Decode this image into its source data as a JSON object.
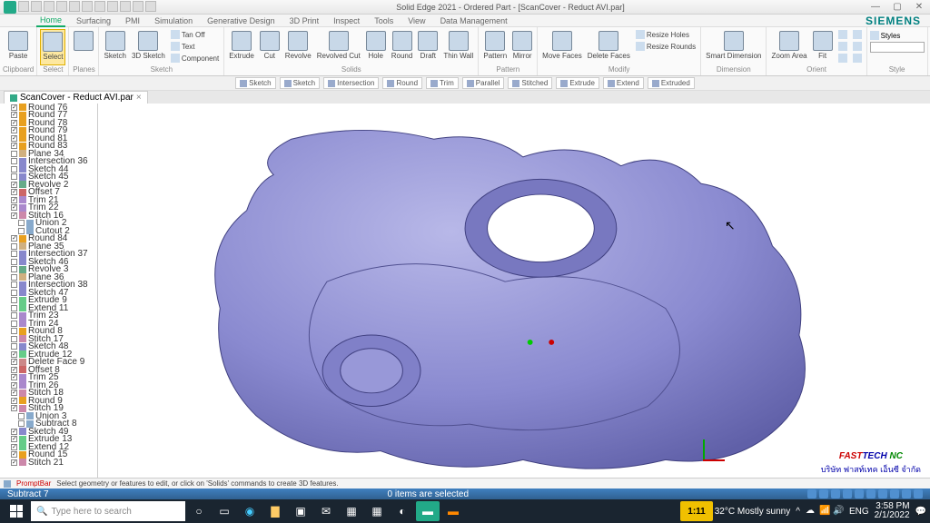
{
  "titlebar": {
    "title": "Solid Edge 2021 - Ordered Part - [ScanCover - Reduct AVI.par]"
  },
  "tabs": [
    "Home",
    "Surfacing",
    "PMI",
    "Simulation",
    "Generative Design",
    "3D Print",
    "Inspect",
    "Tools",
    "View",
    "Data Management"
  ],
  "active_tab": 0,
  "brand": "SIEMENS",
  "ribbon": {
    "clipboard": {
      "label": "Clipboard",
      "paste": "Paste"
    },
    "select": {
      "label": "Select",
      "select": "Select"
    },
    "planes": {
      "label": "Planes"
    },
    "sketch": {
      "label": "Sketch",
      "sketch": "Sketch",
      "sketch3d": "3D Sketch",
      "tanoff": "Tan Off",
      "text": "Text",
      "component": "Component"
    },
    "solids": {
      "label": "Solids",
      "extrude": "Extrude",
      "cut": "Cut",
      "revolve": "Revolve",
      "revolvedcut": "Revolved Cut",
      "hole": "Hole",
      "round": "Round",
      "draft": "Draft",
      "thinwall": "Thin Wall"
    },
    "pattern": {
      "label": "Pattern",
      "pattern": "Pattern",
      "mirror": "Mirror"
    },
    "modify": {
      "label": "Modify",
      "move": "Move Faces",
      "delete": "Delete Faces",
      "resizeholes": "Resize Holes",
      "resizerounds": "Resize Rounds"
    },
    "dimension": {
      "label": "Dimension",
      "smart": "Smart Dimension"
    },
    "orient": {
      "label": "Orient",
      "zoom": "Zoom Area",
      "fit": "Fit"
    },
    "style": {
      "label": "Style",
      "styles": "Styles"
    }
  },
  "filters": [
    "Sketch",
    "Sketch",
    "Intersection",
    "Round",
    "Trim",
    "Parallel",
    "Stitched",
    "Extrude",
    "Extend",
    "Extruded"
  ],
  "doc_tab": {
    "name": "ScanCover - Reduct AVI.par"
  },
  "tree": [
    {
      "c": 1,
      "t": "round",
      "l": "Round 76",
      "i": 1
    },
    {
      "c": 1,
      "t": "round",
      "l": "Round 77",
      "i": 1
    },
    {
      "c": 1,
      "t": "round",
      "l": "Round 78",
      "i": 1
    },
    {
      "c": 1,
      "t": "round",
      "l": "Round 79",
      "i": 1
    },
    {
      "c": 1,
      "t": "round",
      "l": "Round 81",
      "i": 1
    },
    {
      "c": 1,
      "t": "round",
      "l": "Round 83",
      "i": 1
    },
    {
      "c": 0,
      "t": "plane",
      "l": "Plane 34",
      "i": 1
    },
    {
      "c": 0,
      "t": "sketch",
      "l": "Intersection 36",
      "i": 1
    },
    {
      "c": 0,
      "t": "sketch",
      "l": "Sketch 44",
      "i": 1
    },
    {
      "c": 0,
      "t": "sketch",
      "l": "Sketch 45",
      "i": 1
    },
    {
      "c": 1,
      "t": "revolve",
      "l": "Revolve 2",
      "i": 1
    },
    {
      "c": 1,
      "t": "offset",
      "l": "Offset 7",
      "i": 1
    },
    {
      "c": 1,
      "t": "trim",
      "l": "Trim 21",
      "i": 1
    },
    {
      "c": 1,
      "t": "trim",
      "l": "Trim 22",
      "i": 1
    },
    {
      "c": 1,
      "t": "stitch",
      "l": "Stitch 16",
      "i": 1
    },
    {
      "c": 0,
      "t": "union",
      "l": "Union 2",
      "i": 2
    },
    {
      "c": 0,
      "t": "union",
      "l": "Cutout 2",
      "i": 2
    },
    {
      "c": 1,
      "t": "round",
      "l": "Round 84",
      "i": 1
    },
    {
      "c": 0,
      "t": "plane",
      "l": "Plane 35",
      "i": 1
    },
    {
      "c": 0,
      "t": "sketch",
      "l": "Intersection 37",
      "i": 1
    },
    {
      "c": 0,
      "t": "sketch",
      "l": "Sketch 46",
      "i": 1
    },
    {
      "c": 0,
      "t": "revolve",
      "l": "Revolve 3",
      "i": 1
    },
    {
      "c": 0,
      "t": "plane",
      "l": "Plane 36",
      "i": 1
    },
    {
      "c": 0,
      "t": "sketch",
      "l": "Intersection 38",
      "i": 1
    },
    {
      "c": 0,
      "t": "sketch",
      "l": "Sketch 47",
      "i": 1
    },
    {
      "c": 0,
      "t": "extrude",
      "l": "Extrude 9",
      "i": 1
    },
    {
      "c": 0,
      "t": "extrude",
      "l": "Extend 11",
      "i": 1
    },
    {
      "c": 0,
      "t": "trim",
      "l": "Trim 23",
      "i": 1
    },
    {
      "c": 0,
      "t": "trim",
      "l": "Trim 24",
      "i": 1
    },
    {
      "c": 0,
      "t": "round",
      "l": "Round 8",
      "i": 1
    },
    {
      "c": 0,
      "t": "stitch",
      "l": "Stitch 17",
      "i": 1
    },
    {
      "c": 0,
      "t": "sketch",
      "l": "Sketch 48",
      "i": 1
    },
    {
      "c": 1,
      "t": "extrude",
      "l": "Extrude 12",
      "i": 1
    },
    {
      "c": 1,
      "t": "delete",
      "l": "Delete Face 9",
      "i": 1
    },
    {
      "c": 1,
      "t": "offset",
      "l": "Offset 8",
      "i": 1
    },
    {
      "c": 1,
      "t": "trim",
      "l": "Trim 25",
      "i": 1
    },
    {
      "c": 1,
      "t": "trim",
      "l": "Trim 26",
      "i": 1
    },
    {
      "c": 1,
      "t": "stitch",
      "l": "Stitch 18",
      "i": 1
    },
    {
      "c": 1,
      "t": "round",
      "l": "Round 9",
      "i": 1
    },
    {
      "c": 1,
      "t": "stitch",
      "l": "Stitch 19",
      "i": 1
    },
    {
      "c": 0,
      "t": "union",
      "l": "Union 3",
      "i": 2
    },
    {
      "c": 0,
      "t": "union",
      "l": "Subtract 8",
      "i": 2
    },
    {
      "c": 1,
      "t": "sketch",
      "l": "Sketch 49",
      "i": 1
    },
    {
      "c": 1,
      "t": "extrude",
      "l": "Extrude 13",
      "i": 1
    },
    {
      "c": 1,
      "t": "extrude",
      "l": "Extend 12",
      "i": 1
    },
    {
      "c": 1,
      "t": "round",
      "l": "Round 15",
      "i": 1
    },
    {
      "c": 1,
      "t": "stitch",
      "l": "Stitch 21",
      "i": 1
    }
  ],
  "prompt": {
    "label": "PromptBar",
    "text": "Select geometry or features to edit, or click on 'Solids' commands to create 3D features."
  },
  "status": {
    "left": "Subtract 7",
    "mid": "0 items are selected"
  },
  "watermark": {
    "logo_a": "FAST",
    "logo_b": "TECH",
    "logo_c": " NC",
    "sub": "บริษัท  ฟาสท์เทค  เอ็นซี  จำกัด"
  },
  "taskbar": {
    "search": "Type here to search",
    "weather": "32°C Mostly sunny",
    "timebox": "1:11",
    "time": "3:58 PM",
    "date": "2/1/2022",
    "lang": "ENG"
  }
}
